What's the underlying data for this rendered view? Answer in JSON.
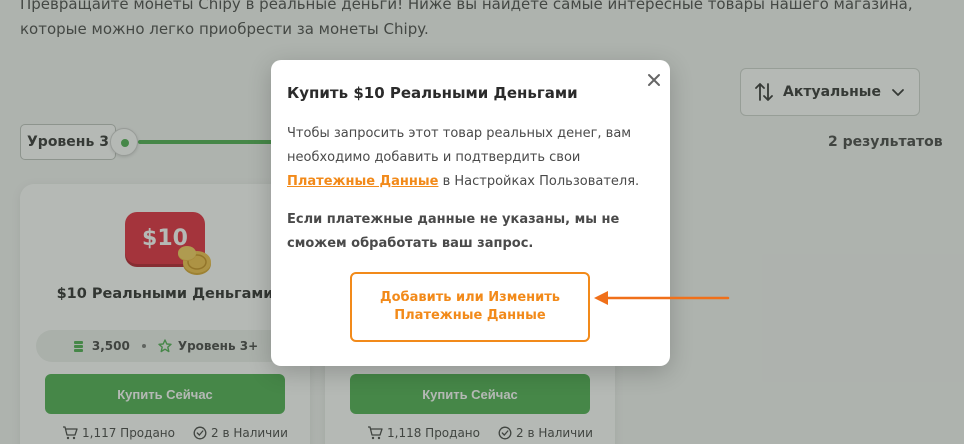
{
  "intro": {
    "line1": "Превращайте монеты Chipy в реальные деньги! Ниже вы найдете самые интересные товары нашего магазина,",
    "line2": "которые можно легко приобрести за монеты Chipy."
  },
  "filters": {
    "sort_label": "Актуальные",
    "level_label": "Уровень 3",
    "results_label": "2 результатов"
  },
  "cards": [
    {
      "badge": "$10",
      "title": "$10 Реальными Деньгами",
      "price": "3,500",
      "level": "Уровень 3+",
      "buy_label": "Купить Сейчас",
      "sold": "1,117 Продано",
      "stock": "2 в Наличии"
    },
    {
      "badge": "",
      "title": "",
      "price": "",
      "level": "",
      "buy_label": "Купить Сейчас",
      "sold": "1,118 Продано",
      "stock": "2 в Наличии"
    }
  ],
  "modal": {
    "title": "Купить $10 Реальными Деньгами",
    "body_before": "Чтобы запросить этот товар реальных денег, вам необходимо добавить и подтвердить свои ",
    "body_link": "Платежные Данные",
    "body_after": " в Настройках Пользователя.",
    "warning": "Если платежные данные не указаны, мы не сможем обработать ваш запрос.",
    "action_line1": "Добавить или Изменить",
    "action_line2": "Платежные Данные"
  },
  "colors": {
    "accent_orange": "#f28a1a",
    "buy_green": "#4caf50",
    "badge_red": "#e4293c"
  }
}
